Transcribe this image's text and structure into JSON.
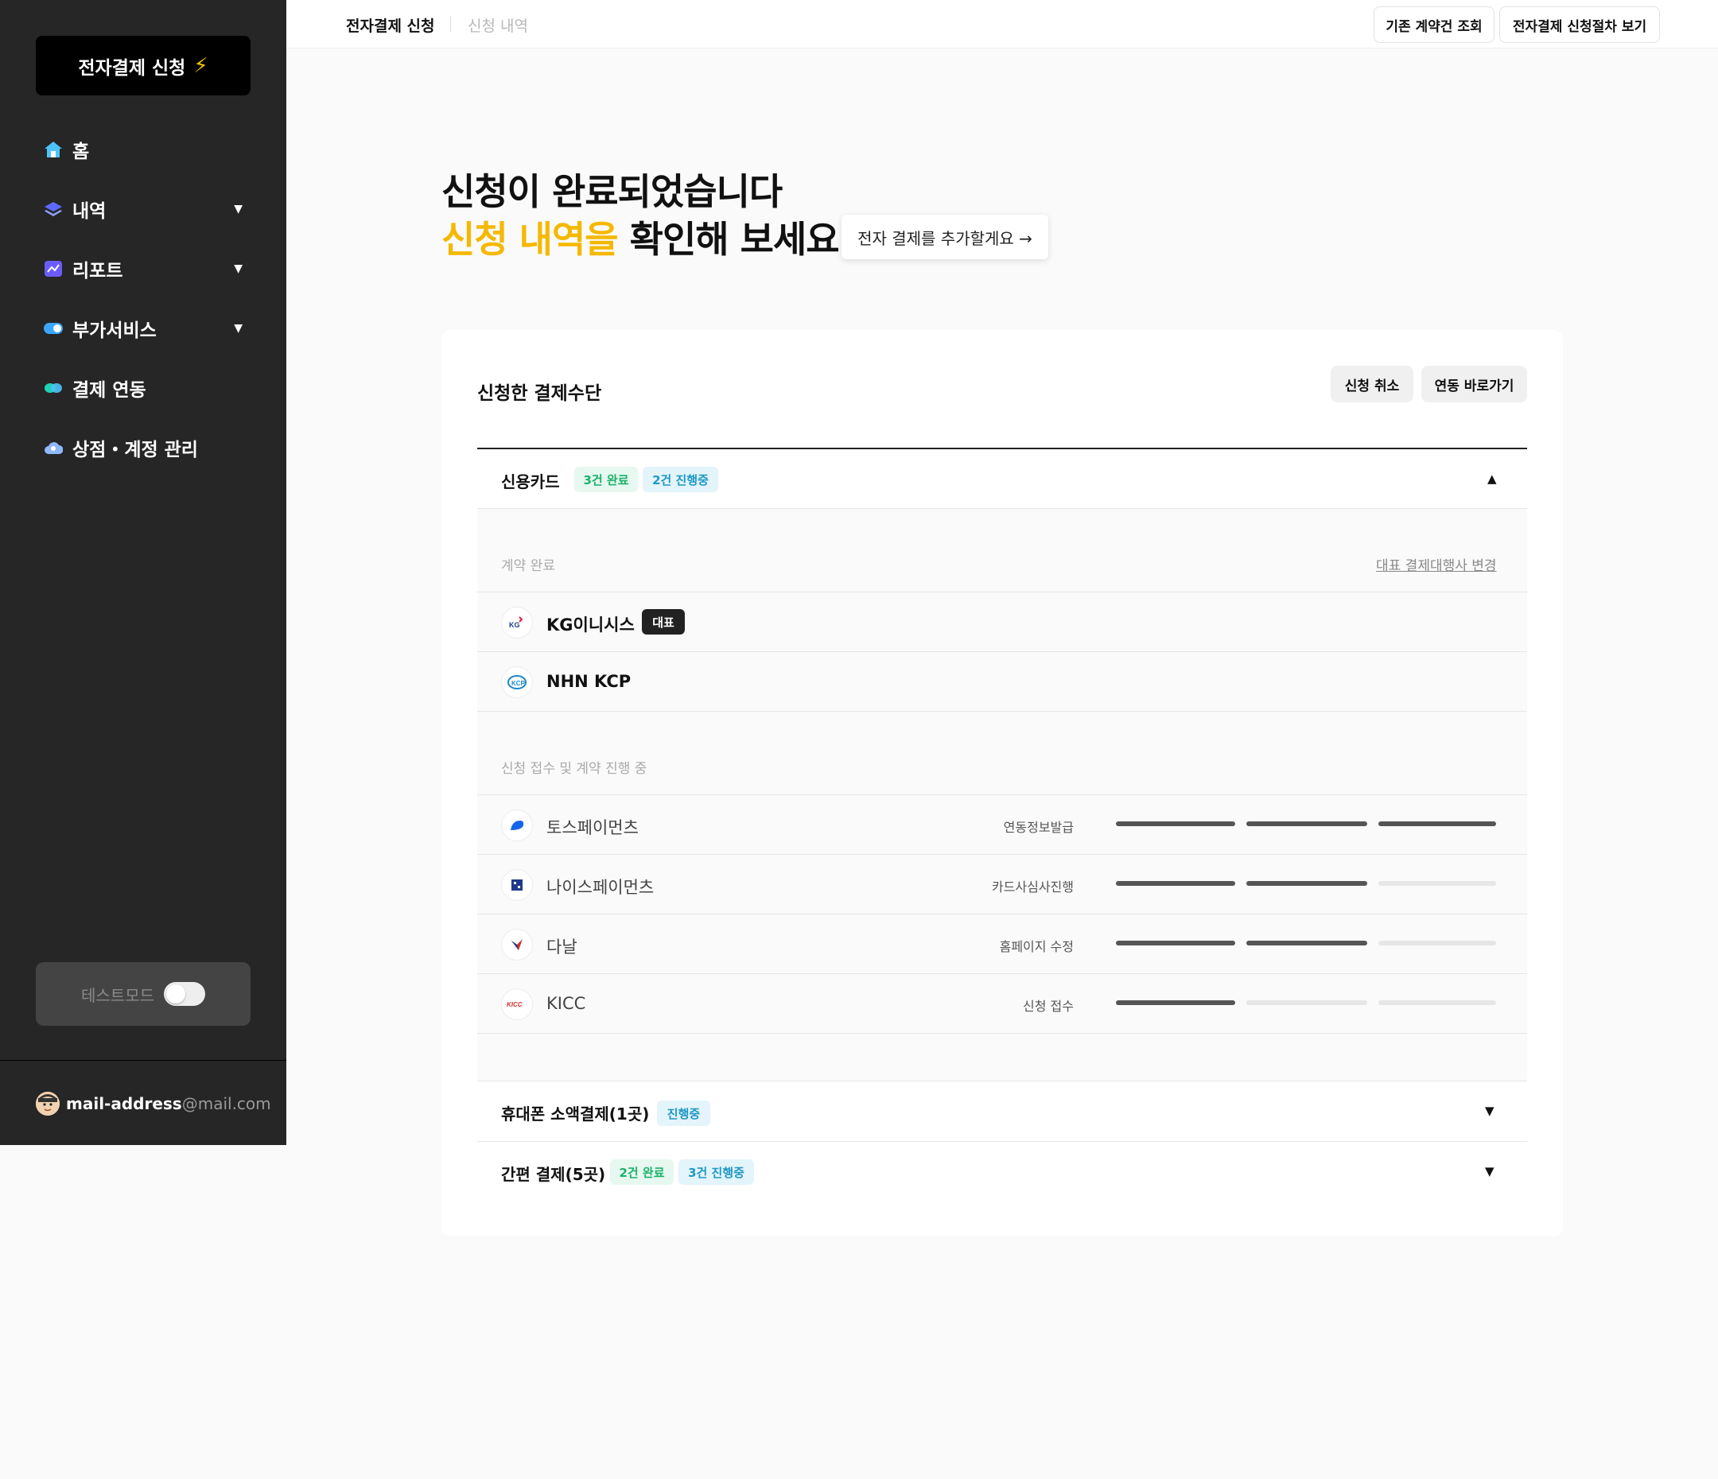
{
  "sidebar": {
    "apply_button": "전자결제 신청",
    "nav": [
      {
        "label": "홈",
        "icon": "home-icon",
        "has_caret": false
      },
      {
        "label": "내역",
        "icon": "layers-icon",
        "has_caret": true
      },
      {
        "label": "리포트",
        "icon": "chart-icon",
        "has_caret": true
      },
      {
        "label": "부가서비스",
        "icon": "toggle-icon",
        "has_caret": true
      },
      {
        "label": "결제 연동",
        "icon": "link-icon",
        "has_caret": false
      },
      {
        "label": "상점・계정 관리",
        "icon": "cloud-icon",
        "has_caret": false
      }
    ],
    "test_mode_label": "테스트모드",
    "test_mode_on": false,
    "account": {
      "user": "mail-address",
      "domain": "@mail.com"
    }
  },
  "topbar": {
    "tab_active": "전자결제 신청",
    "tab_inactive": "신청 내역",
    "btn_existing": "기존 계약건 조회",
    "btn_procedure": "전자결제 신청절차 보기"
  },
  "hero": {
    "line1": "신청이 완료되었습니다",
    "line2_accent": "신청 내역을",
    "line2_rest": " 확인해 보세요",
    "add_button": "전자 결제를 추가할게요 →"
  },
  "card": {
    "title": "신청한 결제수단",
    "cancel_button": "신청 취소",
    "link_button": "연동 바로가기",
    "credit_card": {
      "title": "신용카드",
      "badge_done": "3건 완료",
      "badge_progress": "2건 진행중",
      "contracted_label": "계약 완료",
      "change_link": "대표 결제대행사 변경",
      "contracted": [
        {
          "name": "KG이니시스",
          "logo": "KG",
          "rep": "대표"
        },
        {
          "name": "NHN KCP",
          "logo": "KCP"
        }
      ],
      "pending_label": "신청 접수 및 계약 진행 중",
      "pending": [
        {
          "name": "토스페이먼츠",
          "status": "연동정보발급",
          "steps_done": 3
        },
        {
          "name": "나이스페이먼츠",
          "status": "카드사심사진행",
          "steps_done": 2
        },
        {
          "name": "다날",
          "status": "홈페이지 수정",
          "steps_done": 2
        },
        {
          "name": "KICC",
          "status": "신청 접수",
          "steps_done": 1
        }
      ]
    },
    "mobile": {
      "title": "휴대폰 소액결제(1곳)",
      "badge": "진행중"
    },
    "easy": {
      "title": "간편 결제(5곳)",
      "badge_done": "2건 완료",
      "badge_progress": "3건 진행중"
    }
  },
  "colors": {
    "accent": "#f5b800",
    "sidebar": "#262626"
  }
}
